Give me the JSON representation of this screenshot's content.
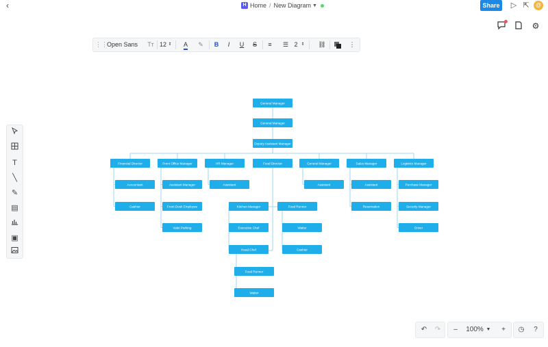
{
  "topbar": {
    "back_icon": "chevron-left-icon",
    "logo_letter": "H",
    "home_label": "Home",
    "separator": "/",
    "document_title": "New Diagram",
    "share_label": "Share",
    "accent_color": "#1e88e5",
    "avatar_initial": "@"
  },
  "format_toolbar": {
    "font_family": "Open Sans",
    "font_size": "12",
    "line_spacing": "2"
  },
  "zoom": {
    "level": "100%"
  },
  "diagram": {
    "node_color": "#1faeea",
    "line_color": "#9fd5f0",
    "nodes": [
      {
        "id": "gm1",
        "label": "General Manager"
      },
      {
        "id": "gm2",
        "label": "General Manager"
      },
      {
        "id": "dam",
        "label": "Deputy Assistant Manager"
      },
      {
        "id": "fd",
        "label": "Financial Director"
      },
      {
        "id": "fom",
        "label": "Front Office Manager"
      },
      {
        "id": "hr",
        "label": "HR Manager"
      },
      {
        "id": "food",
        "label": "Food Director"
      },
      {
        "id": "genm",
        "label": "General Manager"
      },
      {
        "id": "sales",
        "label": "Sales Manager"
      },
      {
        "id": "log",
        "label": "Logistics Manager"
      },
      {
        "id": "acc",
        "label": "Accountant"
      },
      {
        "id": "cash",
        "label": "Cashier"
      },
      {
        "id": "am",
        "label": "Assistant Manager"
      },
      {
        "id": "fde",
        "label": "Front Desk Employee"
      },
      {
        "id": "valet",
        "label": "Valet Parking"
      },
      {
        "id": "hrasst",
        "label": "Assistant"
      },
      {
        "id": "km",
        "label": "Kitchen Manager"
      },
      {
        "id": "ec",
        "label": "Executive Chef"
      },
      {
        "id": "hc",
        "label": "Head Chef"
      },
      {
        "id": "fr1",
        "label": "Food Runner"
      },
      {
        "id": "wt1",
        "label": "Waiter"
      },
      {
        "id": "fr2",
        "label": "Food Runner"
      },
      {
        "id": "ca2",
        "label": "Cashier"
      },
      {
        "id": "gasst",
        "label": "Assistant"
      },
      {
        "id": "ssasst",
        "label": "Assistant"
      },
      {
        "id": "resv",
        "label": "Reservation"
      },
      {
        "id": "pm",
        "label": "Purchase Manager"
      },
      {
        "id": "sm",
        "label": "Security Manager"
      },
      {
        "id": "drv",
        "label": "Driver"
      },
      {
        "id": "wt2",
        "label": "Waiter"
      }
    ]
  }
}
